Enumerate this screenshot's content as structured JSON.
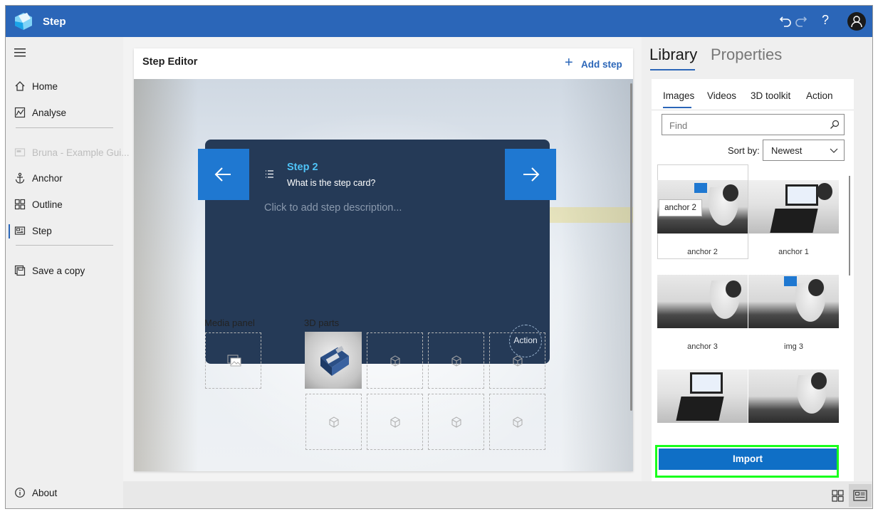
{
  "app": {
    "title": "Step"
  },
  "titlebar": {
    "undo_icon": "undo-icon",
    "redo_icon": "redo-icon",
    "help_glyph": "?"
  },
  "nav": {
    "items": [
      {
        "label": "Home",
        "icon": "home-icon"
      },
      {
        "label": "Analyse",
        "icon": "analyse-icon"
      },
      {
        "label": "Bruna - Example Gui...",
        "icon": "guide-icon",
        "disabled": true
      },
      {
        "label": "Anchor",
        "icon": "anchor-icon"
      },
      {
        "label": "Outline",
        "icon": "outline-icon"
      },
      {
        "label": "Step",
        "icon": "step-icon",
        "active": true
      },
      {
        "label": "Save a copy",
        "icon": "save-copy-icon"
      },
      {
        "label": "About",
        "icon": "info-icon"
      }
    ]
  },
  "editor": {
    "title": "Step Editor",
    "add_step": "Add step",
    "card": {
      "step_label": "Step 2",
      "question": "What is the step card?",
      "description_placeholder": "Click to add step description...",
      "action_label": "Action"
    },
    "media_panel_label": "Media panel",
    "parts_label": "3D parts"
  },
  "right_panel": {
    "tabs": [
      "Library",
      "Properties"
    ],
    "active_tab": "Library",
    "library": {
      "subtabs": [
        "Images",
        "Videos",
        "3D toolkit",
        "Action"
      ],
      "active_subtab": "Images",
      "search_placeholder": "Find",
      "sort_label": "Sort by:",
      "sort_value": "Newest",
      "items": [
        {
          "caption": "anchor 2"
        },
        {
          "caption": "anchor 1"
        },
        {
          "caption": "anchor 3"
        },
        {
          "caption": "img 3"
        },
        {
          "caption": ""
        },
        {
          "caption": ""
        }
      ],
      "tooltip": "anchor 2",
      "import_label": "Import"
    }
  },
  "colors": {
    "accent": "#2b66b8",
    "card": "#253a57",
    "card_nav": "#1f78d1",
    "step_label": "#4fc3f7",
    "highlight": "#18ff1c"
  }
}
